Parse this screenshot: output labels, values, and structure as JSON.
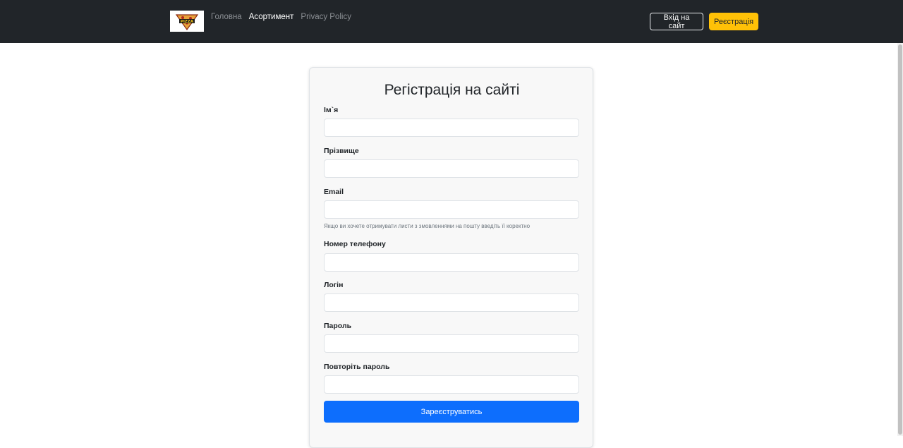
{
  "navbar": {
    "logo_text": "PIZZA",
    "links": [
      {
        "label": "Головна",
        "active": false
      },
      {
        "label": "Асортимент",
        "active": true
      },
      {
        "label": "Privacy Policy",
        "active": false
      }
    ],
    "login_label": "Вхід на сайт",
    "register_label": "Реєстрація"
  },
  "form": {
    "title": "Регістрація на сайті",
    "fields": {
      "first_name": {
        "label": "Ім`я",
        "value": ""
      },
      "last_name": {
        "label": "Прізвище",
        "value": ""
      },
      "email": {
        "label": "Email",
        "value": "",
        "help": "Якщо ви хочете отримувати листи з змовленнями на пошту введіть її коректно"
      },
      "phone": {
        "label": "Номер телефону",
        "value": ""
      },
      "login": {
        "label": "Логін",
        "value": ""
      },
      "password": {
        "label": "Пароль",
        "value": ""
      },
      "password_repeat": {
        "label": "Повторіть пароль",
        "value": ""
      }
    },
    "submit_label": "Зареєструватись"
  },
  "colors": {
    "navbar_bg": "#212529",
    "accent_yellow": "#ffc107",
    "primary_blue": "#0d6efd"
  }
}
